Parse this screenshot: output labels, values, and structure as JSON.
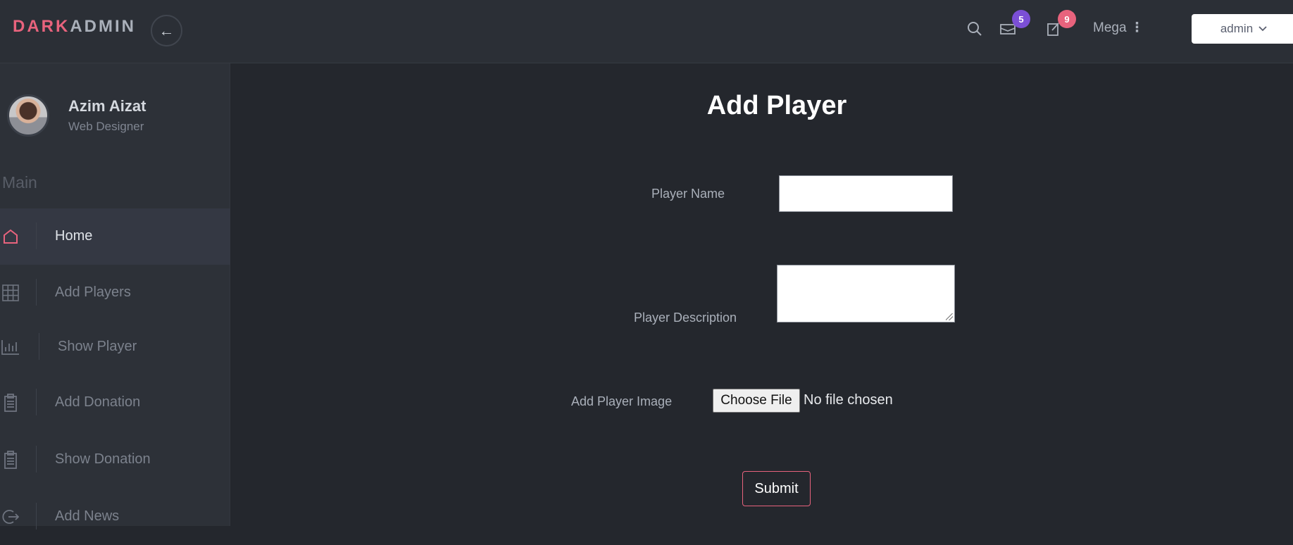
{
  "header": {
    "brand_part1": "DARK",
    "brand_part2": "ADMIN",
    "back_arrow": "←",
    "messages_badge": "5",
    "notifications_badge": "9",
    "mega_label": "Mega",
    "admin_label": "admin",
    "colors": {
      "brand_accent": "#e8637d",
      "badge_messages": "#7b4fd6",
      "badge_notifications": "#e8637d"
    }
  },
  "sidebar": {
    "profile": {
      "name": "Azim Aizat",
      "role": "Web Designer"
    },
    "section_label": "Main",
    "items": [
      {
        "label": "Home",
        "icon": "home-icon",
        "active": true
      },
      {
        "label": "Add Players",
        "icon": "grid-icon",
        "active": false
      },
      {
        "label": "Show Player",
        "icon": "bar-chart-icon",
        "active": false
      },
      {
        "label": "Add Donation",
        "icon": "clipboard-icon",
        "active": false
      },
      {
        "label": "Show Donation",
        "icon": "clipboard-icon",
        "active": false
      },
      {
        "label": "Add News",
        "icon": "logout-icon",
        "active": false
      }
    ]
  },
  "form": {
    "title": "Add Player",
    "player_name_label": "Player Name",
    "player_name_value": "",
    "player_description_label": "Player Description",
    "player_description_value": "",
    "player_image_label": "Add Player Image",
    "file_button_label": "Choose File",
    "file_status": "No file chosen",
    "submit_label": "Submit"
  }
}
